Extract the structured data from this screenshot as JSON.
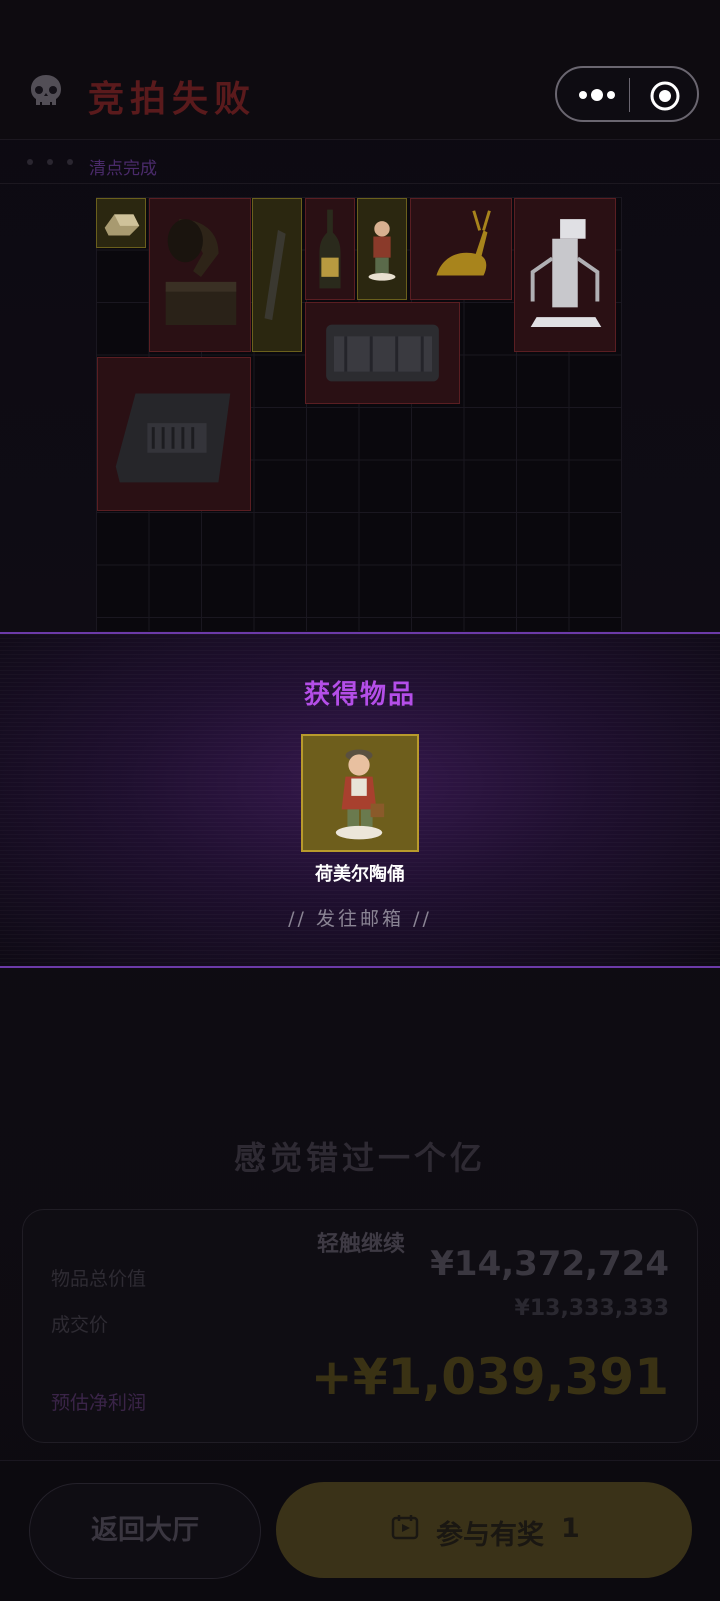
{
  "header": {
    "title": "竞拍失败",
    "subtitle": "清点完成"
  },
  "panel": {
    "title": "获得物品",
    "item_name": "荷美尔陶俑",
    "mail_tip": "// 发往邮箱 //"
  },
  "result": {
    "miss_text": "感觉错过一个亿",
    "tap_continue": "轻触继续",
    "total_value_label": "物品总价值",
    "total_value": "¥14,372,724",
    "deal_price_label": "成交价",
    "deal_price": "¥13,333,333",
    "profit_label": "预估净利润",
    "profit": "+¥1,039,391"
  },
  "footer": {
    "back_label": "返回大厅",
    "join_label": "参与有奖",
    "join_count": "1"
  },
  "items": [
    {
      "name": "gold-bar-crate",
      "rarity": "gold"
    },
    {
      "name": "gramophone",
      "rarity": "red"
    },
    {
      "name": "scroll-tube",
      "rarity": "gold"
    },
    {
      "name": "champagne-bottle",
      "rarity": "red"
    },
    {
      "name": "hummel-figurine",
      "rarity": "gold"
    },
    {
      "name": "golden-deer",
      "rarity": "red"
    },
    {
      "name": "medical-robot",
      "rarity": "red"
    },
    {
      "name": "hard-case",
      "rarity": "red"
    },
    {
      "name": "equipment-case",
      "rarity": "red"
    }
  ],
  "colors": {
    "accent_purple": "#b44ee8",
    "rarity_red": "#5a1e22",
    "rarity_gold": "#6a5f1c"
  }
}
